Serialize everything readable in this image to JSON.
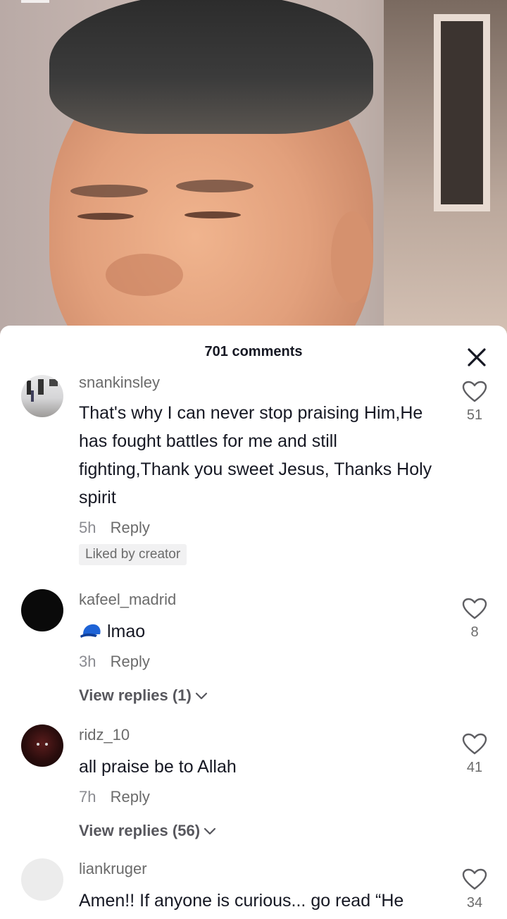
{
  "sheet": {
    "comment_count": "701 comments",
    "reply_label": "Reply",
    "liked_by_creator": "Liked by creator"
  },
  "comments": [
    {
      "username": "snankinsley",
      "text": "That's why I can never stop praising Him,He has fought battles for me and still fighting,Thank you sweet Jesus, Thanks Holy spirit",
      "time": "5h",
      "likes": "51"
    },
    {
      "username": "kafeel_madrid",
      "text": "lmao",
      "emoji": "blue-cap-emoji",
      "time": "3h",
      "likes": "8",
      "view_replies": "View replies (1)"
    },
    {
      "username": "ridz_10",
      "text": "all praise be to Allah",
      "time": "7h",
      "likes": "41",
      "view_replies": "View replies (56)"
    },
    {
      "username": "liankruger",
      "text": "Amen!! If anyone is curious... go read “He",
      "likes": "34"
    }
  ],
  "colors": {
    "primary_text": "#161823",
    "secondary_text": "#6b6b6b",
    "badge_bg": "#f1f1f2"
  }
}
